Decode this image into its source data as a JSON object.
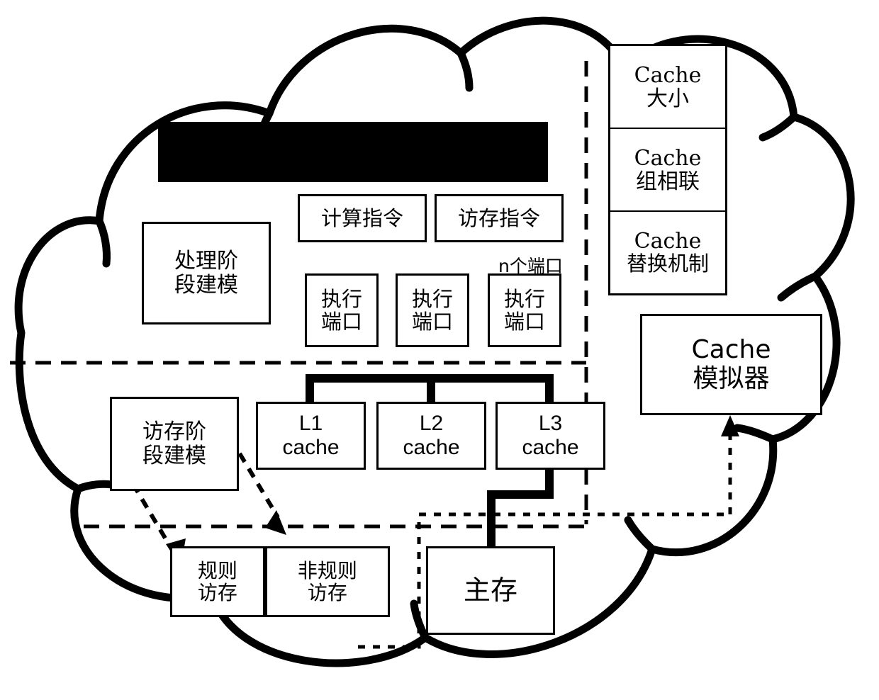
{
  "diagram": {
    "title_redacted": true,
    "cloud_label": "simulation-framework-cloud"
  },
  "boxes": {
    "processing_stage": {
      "line1": "处理阶",
      "line2": "段建模"
    },
    "compute_instruction": {
      "line1": "计算指令"
    },
    "memory_instruction": {
      "line1": "访存指令"
    },
    "exec_port_1": {
      "line1": "执行",
      "line2": "端口"
    },
    "exec_port_2": {
      "line1": "执行",
      "line2": "端口"
    },
    "exec_port_3": {
      "line1": "执行",
      "line2": "端口"
    },
    "n_ports_label": "n个端口",
    "memory_stage": {
      "line1": "访存阶",
      "line2": "段建模"
    },
    "l1_cache": {
      "line1": "L1",
      "line2": "cache"
    },
    "l2_cache": {
      "line1": "L2",
      "line2": "cache"
    },
    "l3_cache": {
      "line1": "L3",
      "line2": "cache"
    },
    "main_memory": {
      "line1": "主存"
    },
    "regular_access": {
      "line1": "规则",
      "line2": "访存"
    },
    "irregular_access": {
      "line1": "非规则",
      "line2": "访存"
    },
    "cache_simulator": {
      "line1": "Cache",
      "line2": "模拟器"
    }
  },
  "cache_params": [
    {
      "line1": "Cache",
      "line2": "大小"
    },
    {
      "line1": "Cache",
      "line2": "组相联"
    },
    {
      "line1": "Cache",
      "line2": "替换机制"
    }
  ],
  "colors": {
    "stroke": "#000000",
    "fill": "#ffffff",
    "redaction": "#000000"
  }
}
